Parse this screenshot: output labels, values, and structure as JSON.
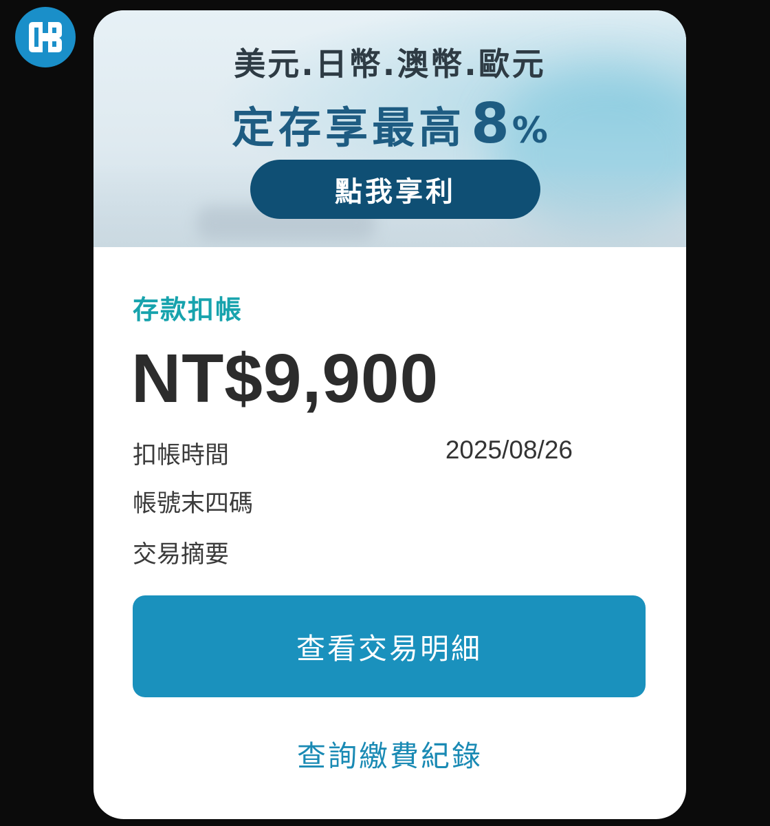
{
  "logo": {
    "icon": "bank-logo-icon",
    "color": "#1a8fc9"
  },
  "banner": {
    "line1": "美元.日幣.澳幣.歐元",
    "line2_text": "定存享最高",
    "line2_number": "8",
    "line2_percent": "%",
    "button_label": "點我享利",
    "text_color": "#2e3b44",
    "accent_color": "#1e5c82",
    "button_color": "#0f4f74"
  },
  "transaction": {
    "type_label": "存款扣帳",
    "amount": "NT$9,900",
    "details": [
      {
        "label": "扣帳時間",
        "value": "2025/08/26"
      },
      {
        "label": "帳號末四碼",
        "value": ""
      },
      {
        "label": "交易摘要",
        "value": ""
      }
    ]
  },
  "actions": {
    "view_details_label": "查看交易明細",
    "payment_history_label": "查詢繳費紀錄",
    "primary_color": "#1a91bd",
    "link_color": "#1a8ab4",
    "label_accent_color": "#17a3ad"
  }
}
